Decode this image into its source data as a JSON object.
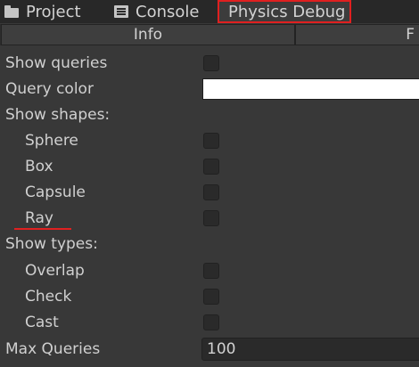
{
  "tabs": {
    "project": "Project",
    "console": "Console",
    "physics_debug": "Physics Debug"
  },
  "subtabs": {
    "info": "Info",
    "next": "F"
  },
  "rows": {
    "show_queries": "Show queries",
    "query_color": "Query color",
    "show_shapes": "Show shapes:",
    "sphere": "Sphere",
    "box": "Box",
    "capsule": "Capsule",
    "ray": "Ray",
    "show_types": "Show types:",
    "overlap": "Overlap",
    "check": "Check",
    "cast": "Cast",
    "max_queries": "Max Queries"
  },
  "values": {
    "query_color": "#ffffff",
    "max_queries": "100",
    "show_queries": false,
    "sphere": false,
    "box": false,
    "capsule": false,
    "ray": false,
    "overlap": false,
    "check": false,
    "cast": false
  },
  "annotations": {
    "highlight_color": "#e02020"
  }
}
